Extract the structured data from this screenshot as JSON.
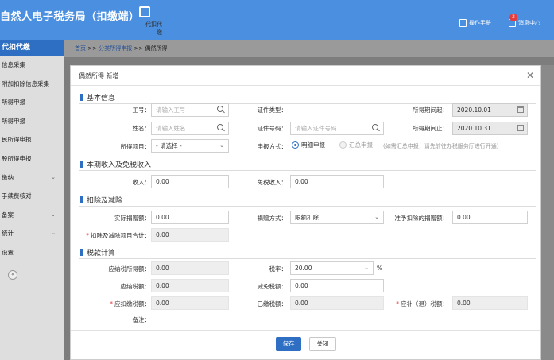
{
  "header": {
    "title": "自然人电子税务局（扣缴端）",
    "module_label": "代扣代缴",
    "manual_label": "操作手册",
    "message_label": "消息中心",
    "message_count": "2"
  },
  "sidebar": {
    "title": "代扣代缴",
    "items": [
      {
        "label": "信息采集"
      },
      {
        "label": "附加扣除信息采集"
      },
      {
        "label": "所得申报"
      },
      {
        "label": "所得申报"
      },
      {
        "label": "民所得申报"
      },
      {
        "label": "股所得申报"
      },
      {
        "label": "缴纳",
        "chevron": "⌄"
      },
      {
        "label": "手续费核对"
      },
      {
        "label": "备案",
        "chevron": "⌄"
      },
      {
        "label": "统计",
        "chevron": "⌄"
      },
      {
        "label": "设置"
      }
    ],
    "collapse_label": "«"
  },
  "breadcrumb": {
    "home": "首页",
    "sep1": ">>",
    "level1": "分类所得申报",
    "sep2": ">>",
    "level2": "偶然所得"
  },
  "modal": {
    "title": "偶然所得 新增",
    "close": "✕",
    "sections": {
      "basic": "基本信息",
      "income": "本期收入及免税收入",
      "deduction": "扣除及减除",
      "tax": "税款计算"
    },
    "basic": {
      "emp_no_label": "工号：",
      "emp_no_placeholder": "请输入工号",
      "id_type_label": "证件类型：",
      "period_start_label": "所得期间起：",
      "period_start": "2020.10.01",
      "name_label": "姓名：",
      "name_placeholder": "请输入姓名",
      "id_no_label": "证件号码：",
      "id_no_placeholder": "请输入证件号码",
      "period_end_label": "所得期间止：",
      "period_end": "2020.10.31",
      "item_label": "所得项目：",
      "item_value": "- 请选择 -",
      "method_label": "申报方式：",
      "method_detail": "明细申报",
      "method_summary": "汇总申报",
      "method_hint": "(如需汇总申报，请先前往办税服务厅进行开通)"
    },
    "income": {
      "income_label": "收入：",
      "income_value": "0.00",
      "exempt_label": "免税收入：",
      "exempt_value": "0.00"
    },
    "deduction": {
      "actual_label": "实际捐赠额：",
      "actual_value": "0.00",
      "method_label": "捐赠方式：",
      "method_value": "限额扣除",
      "allowed_label": "准予扣除的捐赠额：",
      "allowed_value": "0.00",
      "total_label": "扣除及减除项目合计：",
      "total_value": "0.00"
    },
    "tax": {
      "taxable_label": "应纳税所得额：",
      "taxable_value": "0.00",
      "rate_label": "税率：",
      "rate_value": "20.00",
      "rate_unit": "%",
      "payable_label": "应纳税额：",
      "payable_value": "0.00",
      "reduce_label": "减免税额：",
      "reduce_value": "0.00",
      "withhold_label": "应扣缴税额：",
      "withhold_value": "0.00",
      "paid_label": "已缴税额：",
      "paid_value": "0.00",
      "refund_label": "应补（退）税额：",
      "refund_value": "0.00",
      "remark_label": "备注："
    },
    "buttons": {
      "save": "保存",
      "close": "关闭"
    }
  },
  "colors": {
    "brand": "#4a8fe0",
    "primary": "#2e6fc4",
    "required": "#e23b3b"
  }
}
